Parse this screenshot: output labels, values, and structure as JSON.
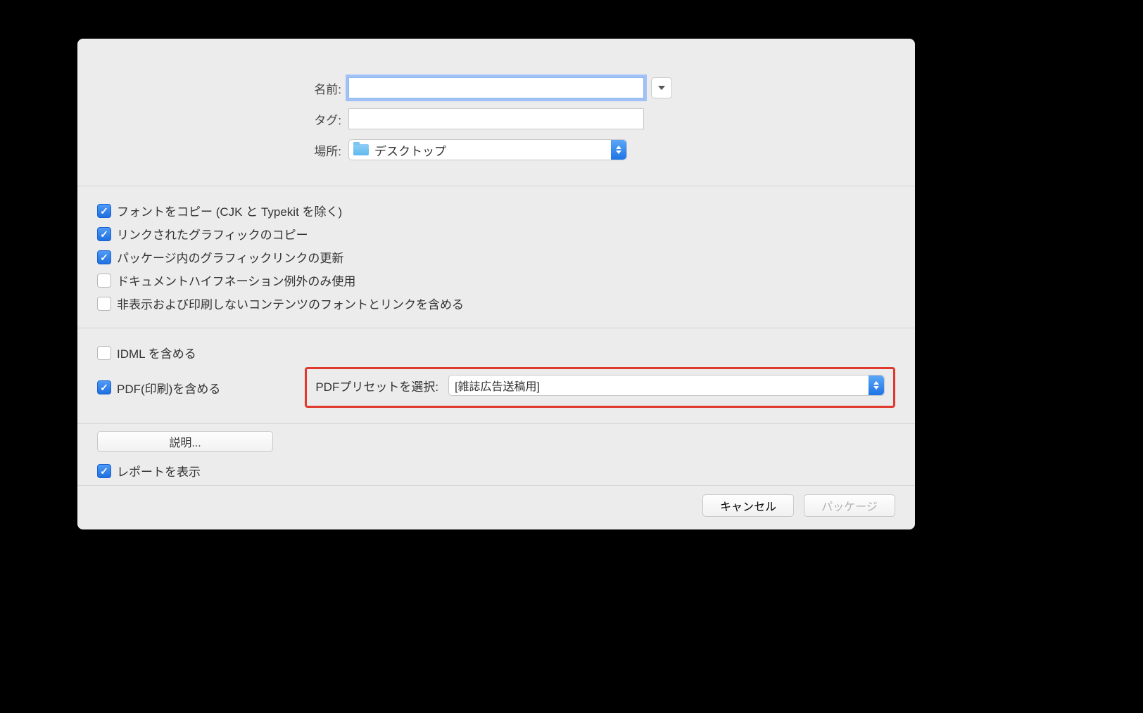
{
  "form": {
    "name_label": "名前:",
    "name_value": "",
    "tags_label": "タグ:",
    "tags_value": "",
    "location_label": "場所:",
    "location_value": "デスクトップ"
  },
  "options": {
    "copy_fonts": {
      "label": "フォントをコピー (CJK と Typekit を除く)",
      "checked": true
    },
    "copy_graphics": {
      "label": "リンクされたグラフィックのコピー",
      "checked": true
    },
    "update_links": {
      "label": "パッケージ内のグラフィックリンクの更新",
      "checked": true
    },
    "hyphenation": {
      "label": "ドキュメントハイフネーション例外のみ使用",
      "checked": false
    },
    "hidden_content": {
      "label": "非表示および印刷しないコンテンツのフォントとリンクを含める",
      "checked": false
    },
    "include_idml": {
      "label": "IDML を含める",
      "checked": false
    },
    "include_pdf": {
      "label": "PDF(印刷)を含める",
      "checked": true
    }
  },
  "preset": {
    "label": "PDFプリセットを選択:",
    "value": "[雑誌広告送稿用]"
  },
  "footer": {
    "instructions_button": "説明...",
    "view_report": {
      "label": "レポートを表示",
      "checked": true
    }
  },
  "actions": {
    "cancel": "キャンセル",
    "package": "パッケージ"
  }
}
